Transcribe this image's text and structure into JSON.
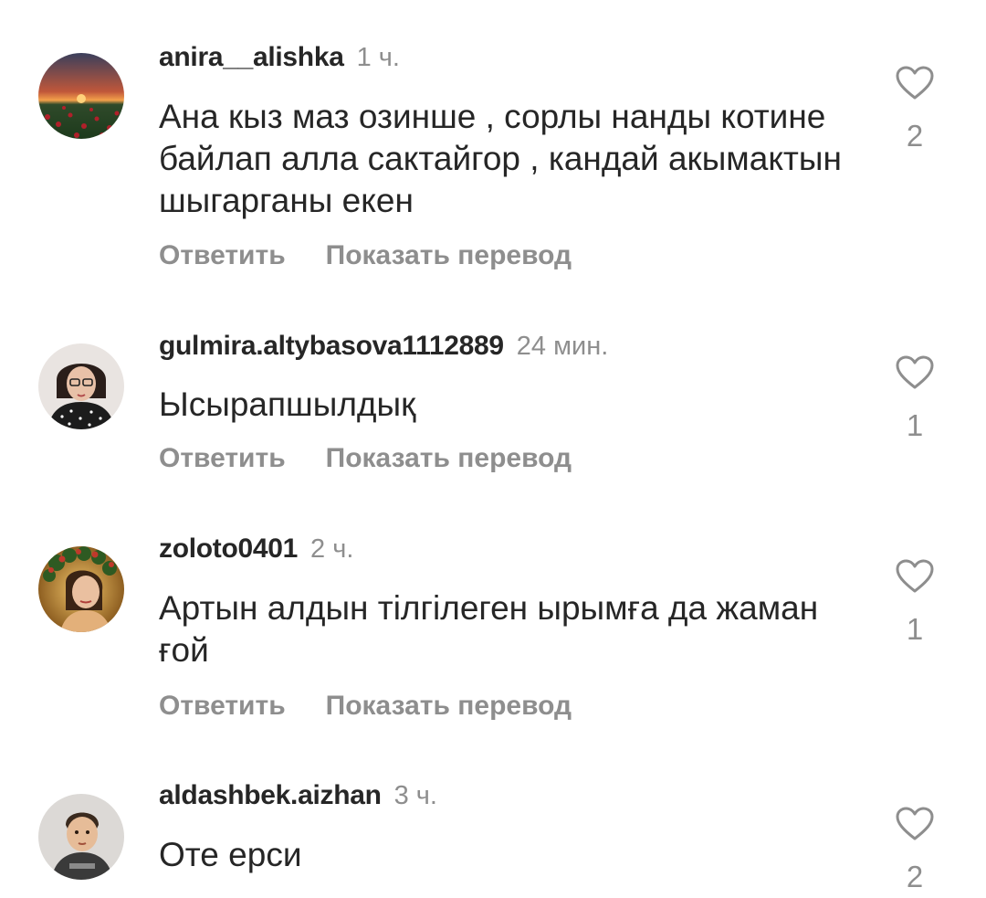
{
  "comments": [
    {
      "username": "anira__alishka",
      "time": "1 ч.",
      "text": "Ана кыз маз озинше , сорлы нанды котине байлап алла сактайгор , кандай акымактын шыгарганы екен",
      "likes": "2",
      "avatar_icon": "sunset-field-avatar"
    },
    {
      "username": "gulmira.altybasova1112889",
      "time": "24 мин.",
      "text": "Ысырапшылдық",
      "likes": "1",
      "avatar_icon": "woman-glasses-avatar"
    },
    {
      "username": "zoloto0401",
      "time": "2 ч.",
      "text": "Артын алдын тілгілеген ырымға да жаман ғой",
      "likes": "1",
      "avatar_icon": "woman-wreath-avatar"
    },
    {
      "username": "aldashbek.aizhan",
      "time": "3 ч.",
      "text": "Оте ерси",
      "likes": "2",
      "avatar_icon": "child-avatar"
    }
  ],
  "actions": {
    "reply_label": "Ответить",
    "translate_label": "Показать перевод"
  },
  "colors": {
    "text": "#262626",
    "secondary": "#8e8e8e",
    "background": "#ffffff"
  }
}
